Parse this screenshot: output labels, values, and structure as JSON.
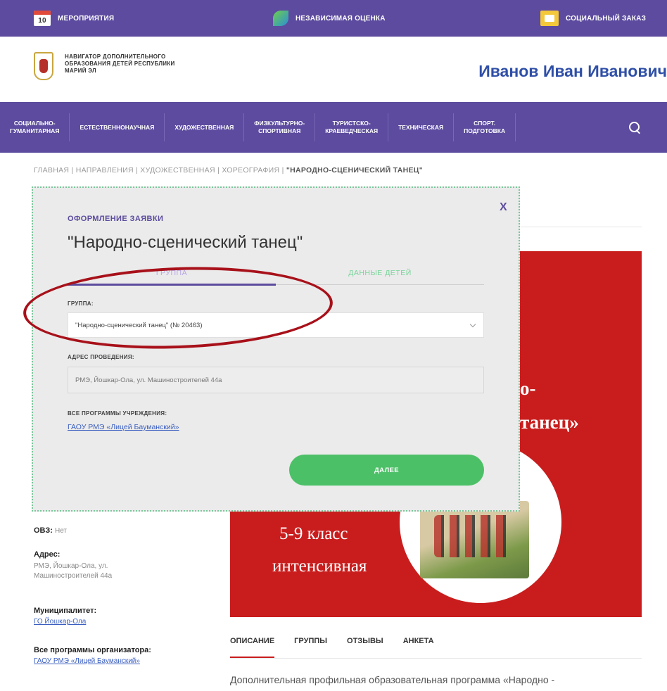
{
  "topbar": {
    "events_day": "10",
    "events_label": "МЕРОПРИЯТИЯ",
    "assessment_label": "НЕЗАВИСИМАЯ ОЦЕНКА",
    "social_order_label": "СОЦИАЛЬНЫЙ ЗАКАЗ"
  },
  "header": {
    "brand_line1": "НАВИГАТОР ДОПОЛНИТЕЛЬНОГО",
    "brand_line2": "ОБРАЗОВАНИЯ ДЕТЕЙ РЕСПУБЛИКИ",
    "brand_line3": "МАРИЙ ЭЛ",
    "user_name": "Иванов Иван Иванович"
  },
  "nav": {
    "items": [
      {
        "line1": "СОЦИАЛЬНО-",
        "line2": "ГУМАНИТАРНАЯ"
      },
      {
        "line1": "ЕСТЕСТВЕННОНАУЧНАЯ",
        "line2": ""
      },
      {
        "line1": "ХУДОЖЕСТВЕННАЯ",
        "line2": ""
      },
      {
        "line1": "ФИЗКУЛЬТУРНО-",
        "line2": "СПОРТИВНАЯ"
      },
      {
        "line1": "ТУРИСТСКО-",
        "line2": "КРАЕВЕДЧЕСКАЯ"
      },
      {
        "line1": "ТЕХНИЧЕСКАЯ",
        "line2": ""
      },
      {
        "line1": "СПОРТ.",
        "line2": "ПОДГОТОВКА"
      }
    ]
  },
  "breadcrumbs": {
    "path": "ГЛАВНАЯ | НАПРАВЛЕНИЯ | ХУДОЖЕСТВЕННАЯ | ХОРЕОГРАФИЯ | ",
    "current": "\"НАРОДНО-СЦЕНИЧЕСКИЙ ТАНЕЦ\""
  },
  "banner": {
    "line1": "о-",
    "line2": "танец»",
    "line3": "5-9 класс",
    "line4": "интенсивная"
  },
  "sidebar": {
    "ovz_label": "ОВЗ:",
    "ovz_value": "Нет",
    "address_label": "Адрес:",
    "address_value_line1": "РМЭ, Йошкар-Ола, ул.",
    "address_value_line2": "Машиностроителей 44а",
    "municipality_label": "Муниципалитет:",
    "municipality_value": "ГО Йошкар-Ола",
    "all_programs_label": "Все программы организатора:",
    "all_programs_value": "ГАОУ РМЭ «Лицей Бауманский»"
  },
  "content_tabs": {
    "description": "ОПИСАНИЕ",
    "groups": "ГРУППЫ",
    "reviews": "ОТЗЫВЫ",
    "survey": "АНКЕТА"
  },
  "description_text": "Дополнительная профильная образовательная программа «Народно -",
  "modal": {
    "close": "X",
    "kicker": "ОФОРМЛЕНИЕ ЗАЯВКИ",
    "title": "\"Народно-сценический танец\"",
    "tab_group": "ГРУППА",
    "tab_children": "ДАННЫЕ ДЕТЕЙ",
    "group_label": "ГРУППА:",
    "group_value": "\"Народно-сценический танец\" (№ 20463)",
    "address_label": "АДРЕС ПРОВЕДЕНИЯ:",
    "address_value": "РМЭ, Йошкар-Ола, ул. Машиностроителей 44а",
    "all_programs_label": "ВСЕ ПРОГРАММЫ УЧРЕЖДЕНИЯ:",
    "all_programs_link": "ГАОУ РМЭ «Лицей Бауманский»",
    "next_button": "ДАЛЕЕ"
  },
  "colors": {
    "brand_purple": "#5c4b9e",
    "banner_red": "#c91d1d",
    "next_green": "#4cc067",
    "annotation_red": "#a8111a",
    "username_blue": "#2f4fa7"
  }
}
